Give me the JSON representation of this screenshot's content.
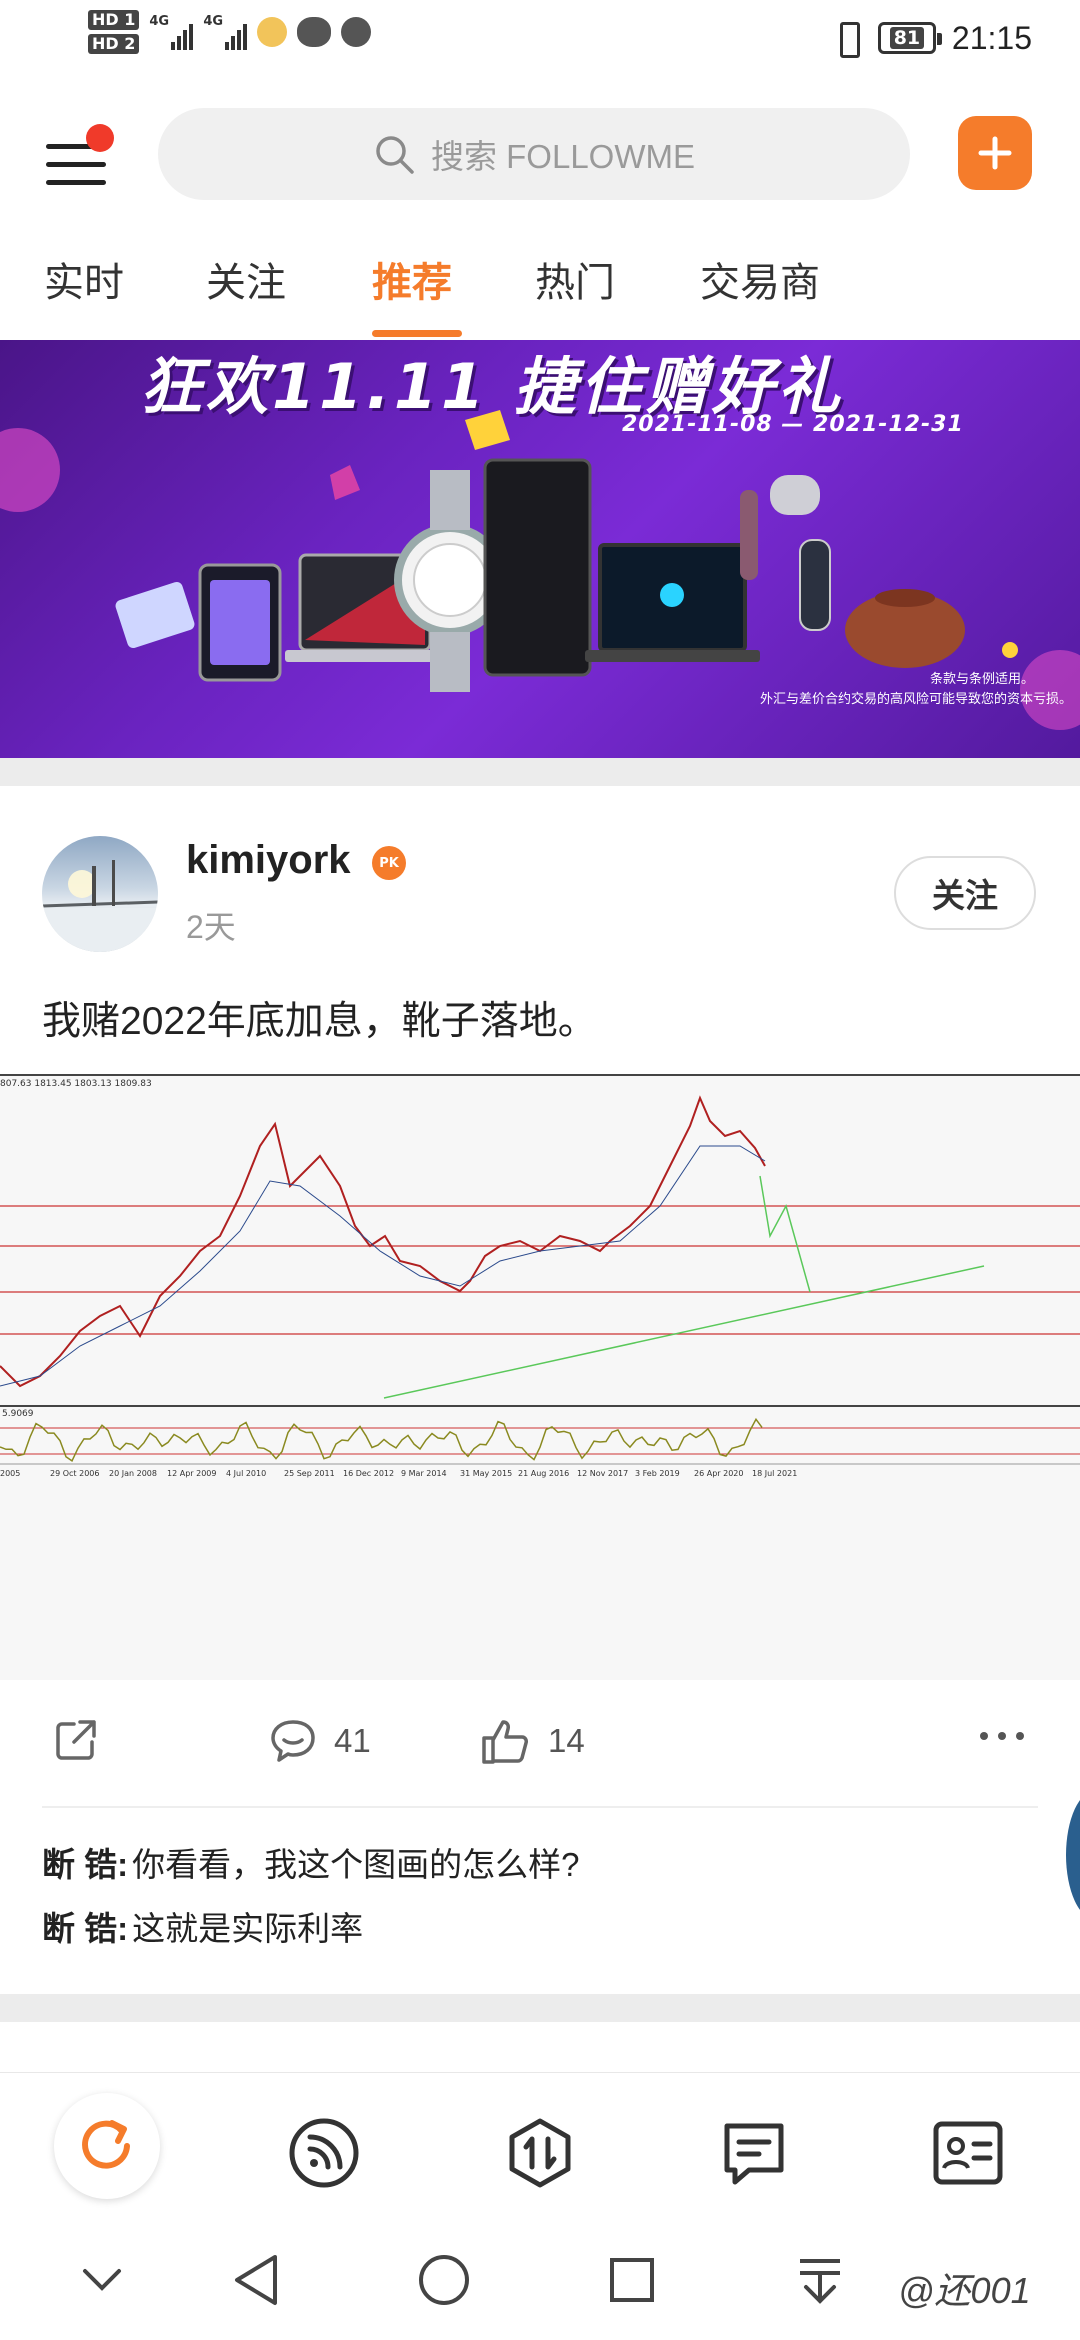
{
  "status_bar": {
    "sim1": "HD 1",
    "sim2": "HD 2",
    "net1": "4G",
    "net2": "4G",
    "battery": "81",
    "time": "21:15"
  },
  "header": {
    "search_placeholder": "搜索 FOLLOWME",
    "notification_dot": true
  },
  "tabs": [
    {
      "label": "实时",
      "active": false
    },
    {
      "label": "关注",
      "active": false
    },
    {
      "label": "推荐",
      "active": true
    },
    {
      "label": "热门",
      "active": false
    },
    {
      "label": "交易商",
      "active": false
    }
  ],
  "banner": {
    "title": "狂欢11.11 捷住赠好礼",
    "date_range": "2021-11-08 — 2021-12-31",
    "note0": "条款与条例适用。",
    "note1": "外汇与差价合约交易的高风险可能导致您的资本亏损。"
  },
  "post": {
    "username": "kimiyork",
    "badge": "PK",
    "time": "2天",
    "follow_label": "关注",
    "text": "我赌2022年底加息，靴子落地。",
    "chart_header": "807.63 1813.45 1803.13 1809.83",
    "osc_label": "5.9069",
    "chart_dates": [
      "2005",
      "29 Oct 2006",
      "20 Jan 2008",
      "12 Apr 2009",
      "4 Jul 2010",
      "25 Sep 2011",
      "16 Dec 2012",
      "9 Mar 2014",
      "31 May 2015",
      "21 Aug 2016",
      "12 Nov 2017",
      "3 Feb 2019",
      "26 Apr 2020",
      "18 Jul 2021"
    ],
    "comment_count": "41",
    "like_count": "14",
    "comments": [
      {
        "author": "断 锆:",
        "text": "你看看，我这个图画的怎么样?"
      },
      {
        "author": "断 锆:",
        "text": "这就是实际利率"
      }
    ]
  },
  "colors": {
    "accent": "#f57c2b",
    "notification": "#f03a2a",
    "banner_purple": "#6a23c0"
  },
  "system_nav": {
    "watermark": "@还001"
  }
}
